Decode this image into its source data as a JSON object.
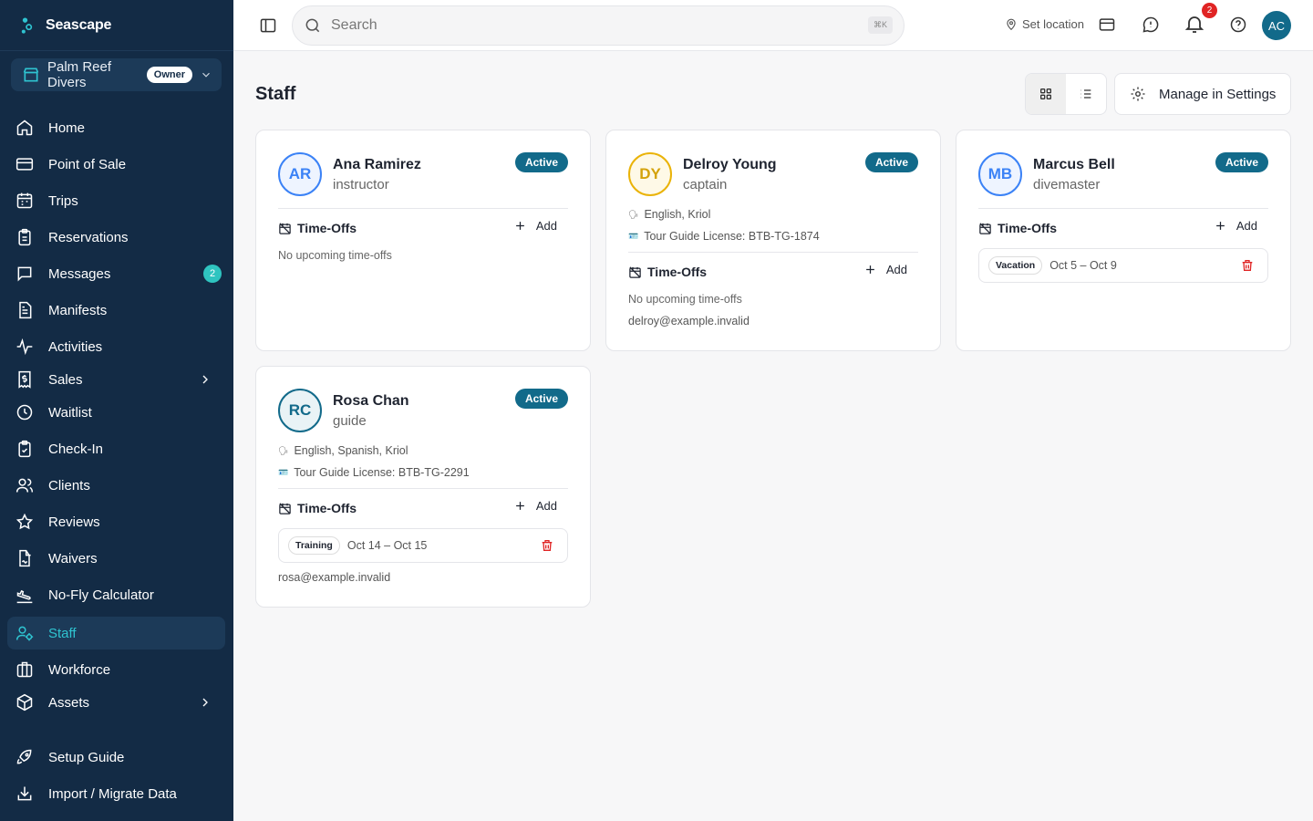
{
  "app": {
    "name": "Seascape"
  },
  "org": {
    "name": "Palm Reef Divers",
    "role_badge": "Owner"
  },
  "nav": [
    {
      "label": "Home",
      "icon": "home-icon"
    },
    {
      "label": "Point of Sale",
      "icon": "credit-card-icon"
    },
    {
      "label": "Trips",
      "icon": "calendar-icon"
    },
    {
      "label": "Reservations",
      "icon": "clipboard-icon"
    },
    {
      "label": "Messages",
      "icon": "message-icon",
      "badge": "2"
    },
    {
      "label": "Manifests",
      "icon": "document-icon"
    },
    {
      "label": "Activities",
      "icon": "activity-icon"
    },
    {
      "label": "Sales",
      "icon": "receipt-dollar-icon",
      "expandable": true
    },
    {
      "label": "Waitlist",
      "icon": "clock-icon"
    },
    {
      "label": "Check-In",
      "icon": "clipboard-check-icon"
    },
    {
      "label": "Clients",
      "icon": "users-icon"
    },
    {
      "label": "Reviews",
      "icon": "star-icon"
    },
    {
      "label": "Waivers",
      "icon": "file-signature-icon"
    },
    {
      "label": "No-Fly Calculator",
      "icon": "plane-landing-icon"
    },
    {
      "label": "Staff",
      "icon": "user-cog-icon",
      "active": true
    },
    {
      "label": "Workforce",
      "icon": "briefcase-icon"
    },
    {
      "label": "Assets",
      "icon": "box-icon",
      "expandable": true
    },
    {
      "label": "Setup Guide",
      "icon": "rocket-icon"
    },
    {
      "label": "Import / Migrate Data",
      "icon": "import-icon"
    }
  ],
  "topbar": {
    "search_placeholder": "Search",
    "shortcut": "⌘K",
    "set_location": "Set location",
    "notifications_count": "2",
    "user_initials": "AC"
  },
  "page": {
    "title": "Staff",
    "manage_label": "Manage in Settings",
    "timeoffs_label": "Time-Offs",
    "add_label": "Add",
    "no_timeoffs": "No upcoming time-offs"
  },
  "staff": [
    {
      "initials": "AR",
      "name": "Ana Ramirez",
      "role": "instructor",
      "status": "Active",
      "color": "#3b82f6"
    },
    {
      "initials": "DY",
      "name": "Delroy Young",
      "role": "captain",
      "status": "Active",
      "color": "#eab308",
      "languages": "English, Kriol",
      "license": "Tour Guide License: BTB-TG-1874",
      "email": "delroy@example.invalid"
    },
    {
      "initials": "MB",
      "name": "Marcus Bell",
      "role": "divemaster",
      "status": "Active",
      "color": "#3b82f6",
      "timeoff": {
        "type": "Vacation",
        "dates": "Oct 5 – Oct 9"
      }
    },
    {
      "initials": "RC",
      "name": "Rosa Chan",
      "role": "guide",
      "status": "Active",
      "color": "#126a8a",
      "languages": "English, Spanish, Kriol",
      "license": "Tour Guide License: BTB-TG-2291",
      "timeoff": {
        "type": "Training",
        "dates": "Oct 14 – Oct 15"
      },
      "email": "rosa@example.invalid"
    }
  ],
  "colors": {
    "sidebar_bg": "#132b45",
    "accent": "#126a8a",
    "active_text": "#2fc4d1",
    "danger": "#e02424"
  }
}
